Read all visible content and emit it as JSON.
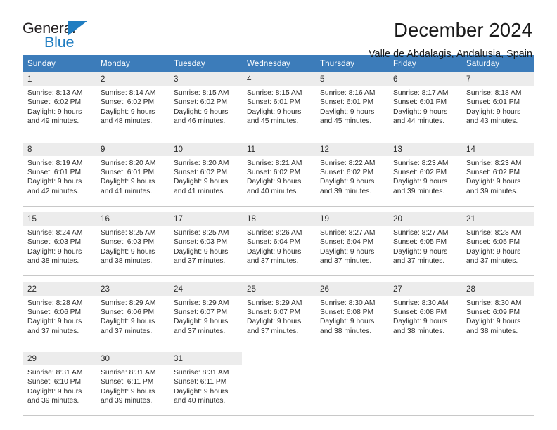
{
  "brand": {
    "name_part1": "General",
    "name_part2": "Blue",
    "accent_color": "#1f7dc1",
    "dark_color": "#231f20"
  },
  "header": {
    "title": "December 2024",
    "subtitle": "Valle de Abdalagis, Andalusia, Spain"
  },
  "calendar": {
    "header_bg": "#3c7cba",
    "date_bar_bg": "#ececec",
    "weekdays": [
      "Sunday",
      "Monday",
      "Tuesday",
      "Wednesday",
      "Thursday",
      "Friday",
      "Saturday"
    ],
    "weeks": [
      [
        {
          "date": "1",
          "sunrise": "Sunrise: 8:13 AM",
          "sunset": "Sunset: 6:02 PM",
          "daylight1": "Daylight: 9 hours",
          "daylight2": "and 49 minutes."
        },
        {
          "date": "2",
          "sunrise": "Sunrise: 8:14 AM",
          "sunset": "Sunset: 6:02 PM",
          "daylight1": "Daylight: 9 hours",
          "daylight2": "and 48 minutes."
        },
        {
          "date": "3",
          "sunrise": "Sunrise: 8:15 AM",
          "sunset": "Sunset: 6:02 PM",
          "daylight1": "Daylight: 9 hours",
          "daylight2": "and 46 minutes."
        },
        {
          "date": "4",
          "sunrise": "Sunrise: 8:15 AM",
          "sunset": "Sunset: 6:01 PM",
          "daylight1": "Daylight: 9 hours",
          "daylight2": "and 45 minutes."
        },
        {
          "date": "5",
          "sunrise": "Sunrise: 8:16 AM",
          "sunset": "Sunset: 6:01 PM",
          "daylight1": "Daylight: 9 hours",
          "daylight2": "and 45 minutes."
        },
        {
          "date": "6",
          "sunrise": "Sunrise: 8:17 AM",
          "sunset": "Sunset: 6:01 PM",
          "daylight1": "Daylight: 9 hours",
          "daylight2": "and 44 minutes."
        },
        {
          "date": "7",
          "sunrise": "Sunrise: 8:18 AM",
          "sunset": "Sunset: 6:01 PM",
          "daylight1": "Daylight: 9 hours",
          "daylight2": "and 43 minutes."
        }
      ],
      [
        {
          "date": "8",
          "sunrise": "Sunrise: 8:19 AM",
          "sunset": "Sunset: 6:01 PM",
          "daylight1": "Daylight: 9 hours",
          "daylight2": "and 42 minutes."
        },
        {
          "date": "9",
          "sunrise": "Sunrise: 8:20 AM",
          "sunset": "Sunset: 6:01 PM",
          "daylight1": "Daylight: 9 hours",
          "daylight2": "and 41 minutes."
        },
        {
          "date": "10",
          "sunrise": "Sunrise: 8:20 AM",
          "sunset": "Sunset: 6:02 PM",
          "daylight1": "Daylight: 9 hours",
          "daylight2": "and 41 minutes."
        },
        {
          "date": "11",
          "sunrise": "Sunrise: 8:21 AM",
          "sunset": "Sunset: 6:02 PM",
          "daylight1": "Daylight: 9 hours",
          "daylight2": "and 40 minutes."
        },
        {
          "date": "12",
          "sunrise": "Sunrise: 8:22 AM",
          "sunset": "Sunset: 6:02 PM",
          "daylight1": "Daylight: 9 hours",
          "daylight2": "and 39 minutes."
        },
        {
          "date": "13",
          "sunrise": "Sunrise: 8:23 AM",
          "sunset": "Sunset: 6:02 PM",
          "daylight1": "Daylight: 9 hours",
          "daylight2": "and 39 minutes."
        },
        {
          "date": "14",
          "sunrise": "Sunrise: 8:23 AM",
          "sunset": "Sunset: 6:02 PM",
          "daylight1": "Daylight: 9 hours",
          "daylight2": "and 39 minutes."
        }
      ],
      [
        {
          "date": "15",
          "sunrise": "Sunrise: 8:24 AM",
          "sunset": "Sunset: 6:03 PM",
          "daylight1": "Daylight: 9 hours",
          "daylight2": "and 38 minutes."
        },
        {
          "date": "16",
          "sunrise": "Sunrise: 8:25 AM",
          "sunset": "Sunset: 6:03 PM",
          "daylight1": "Daylight: 9 hours",
          "daylight2": "and 38 minutes."
        },
        {
          "date": "17",
          "sunrise": "Sunrise: 8:25 AM",
          "sunset": "Sunset: 6:03 PM",
          "daylight1": "Daylight: 9 hours",
          "daylight2": "and 37 minutes."
        },
        {
          "date": "18",
          "sunrise": "Sunrise: 8:26 AM",
          "sunset": "Sunset: 6:04 PM",
          "daylight1": "Daylight: 9 hours",
          "daylight2": "and 37 minutes."
        },
        {
          "date": "19",
          "sunrise": "Sunrise: 8:27 AM",
          "sunset": "Sunset: 6:04 PM",
          "daylight1": "Daylight: 9 hours",
          "daylight2": "and 37 minutes."
        },
        {
          "date": "20",
          "sunrise": "Sunrise: 8:27 AM",
          "sunset": "Sunset: 6:05 PM",
          "daylight1": "Daylight: 9 hours",
          "daylight2": "and 37 minutes."
        },
        {
          "date": "21",
          "sunrise": "Sunrise: 8:28 AM",
          "sunset": "Sunset: 6:05 PM",
          "daylight1": "Daylight: 9 hours",
          "daylight2": "and 37 minutes."
        }
      ],
      [
        {
          "date": "22",
          "sunrise": "Sunrise: 8:28 AM",
          "sunset": "Sunset: 6:06 PM",
          "daylight1": "Daylight: 9 hours",
          "daylight2": "and 37 minutes."
        },
        {
          "date": "23",
          "sunrise": "Sunrise: 8:29 AM",
          "sunset": "Sunset: 6:06 PM",
          "daylight1": "Daylight: 9 hours",
          "daylight2": "and 37 minutes."
        },
        {
          "date": "24",
          "sunrise": "Sunrise: 8:29 AM",
          "sunset": "Sunset: 6:07 PM",
          "daylight1": "Daylight: 9 hours",
          "daylight2": "and 37 minutes."
        },
        {
          "date": "25",
          "sunrise": "Sunrise: 8:29 AM",
          "sunset": "Sunset: 6:07 PM",
          "daylight1": "Daylight: 9 hours",
          "daylight2": "and 37 minutes."
        },
        {
          "date": "26",
          "sunrise": "Sunrise: 8:30 AM",
          "sunset": "Sunset: 6:08 PM",
          "daylight1": "Daylight: 9 hours",
          "daylight2": "and 38 minutes."
        },
        {
          "date": "27",
          "sunrise": "Sunrise: 8:30 AM",
          "sunset": "Sunset: 6:08 PM",
          "daylight1": "Daylight: 9 hours",
          "daylight2": "and 38 minutes."
        },
        {
          "date": "28",
          "sunrise": "Sunrise: 8:30 AM",
          "sunset": "Sunset: 6:09 PM",
          "daylight1": "Daylight: 9 hours",
          "daylight2": "and 38 minutes."
        }
      ],
      [
        {
          "date": "29",
          "sunrise": "Sunrise: 8:31 AM",
          "sunset": "Sunset: 6:10 PM",
          "daylight1": "Daylight: 9 hours",
          "daylight2": "and 39 minutes."
        },
        {
          "date": "30",
          "sunrise": "Sunrise: 8:31 AM",
          "sunset": "Sunset: 6:11 PM",
          "daylight1": "Daylight: 9 hours",
          "daylight2": "and 39 minutes."
        },
        {
          "date": "31",
          "sunrise": "Sunrise: 8:31 AM",
          "sunset": "Sunset: 6:11 PM",
          "daylight1": "Daylight: 9 hours",
          "daylight2": "and 40 minutes."
        },
        {
          "date": "",
          "sunrise": "",
          "sunset": "",
          "daylight1": "",
          "daylight2": ""
        },
        {
          "date": "",
          "sunrise": "",
          "sunset": "",
          "daylight1": "",
          "daylight2": ""
        },
        {
          "date": "",
          "sunrise": "",
          "sunset": "",
          "daylight1": "",
          "daylight2": ""
        },
        {
          "date": "",
          "sunrise": "",
          "sunset": "",
          "daylight1": "",
          "daylight2": ""
        }
      ]
    ]
  }
}
